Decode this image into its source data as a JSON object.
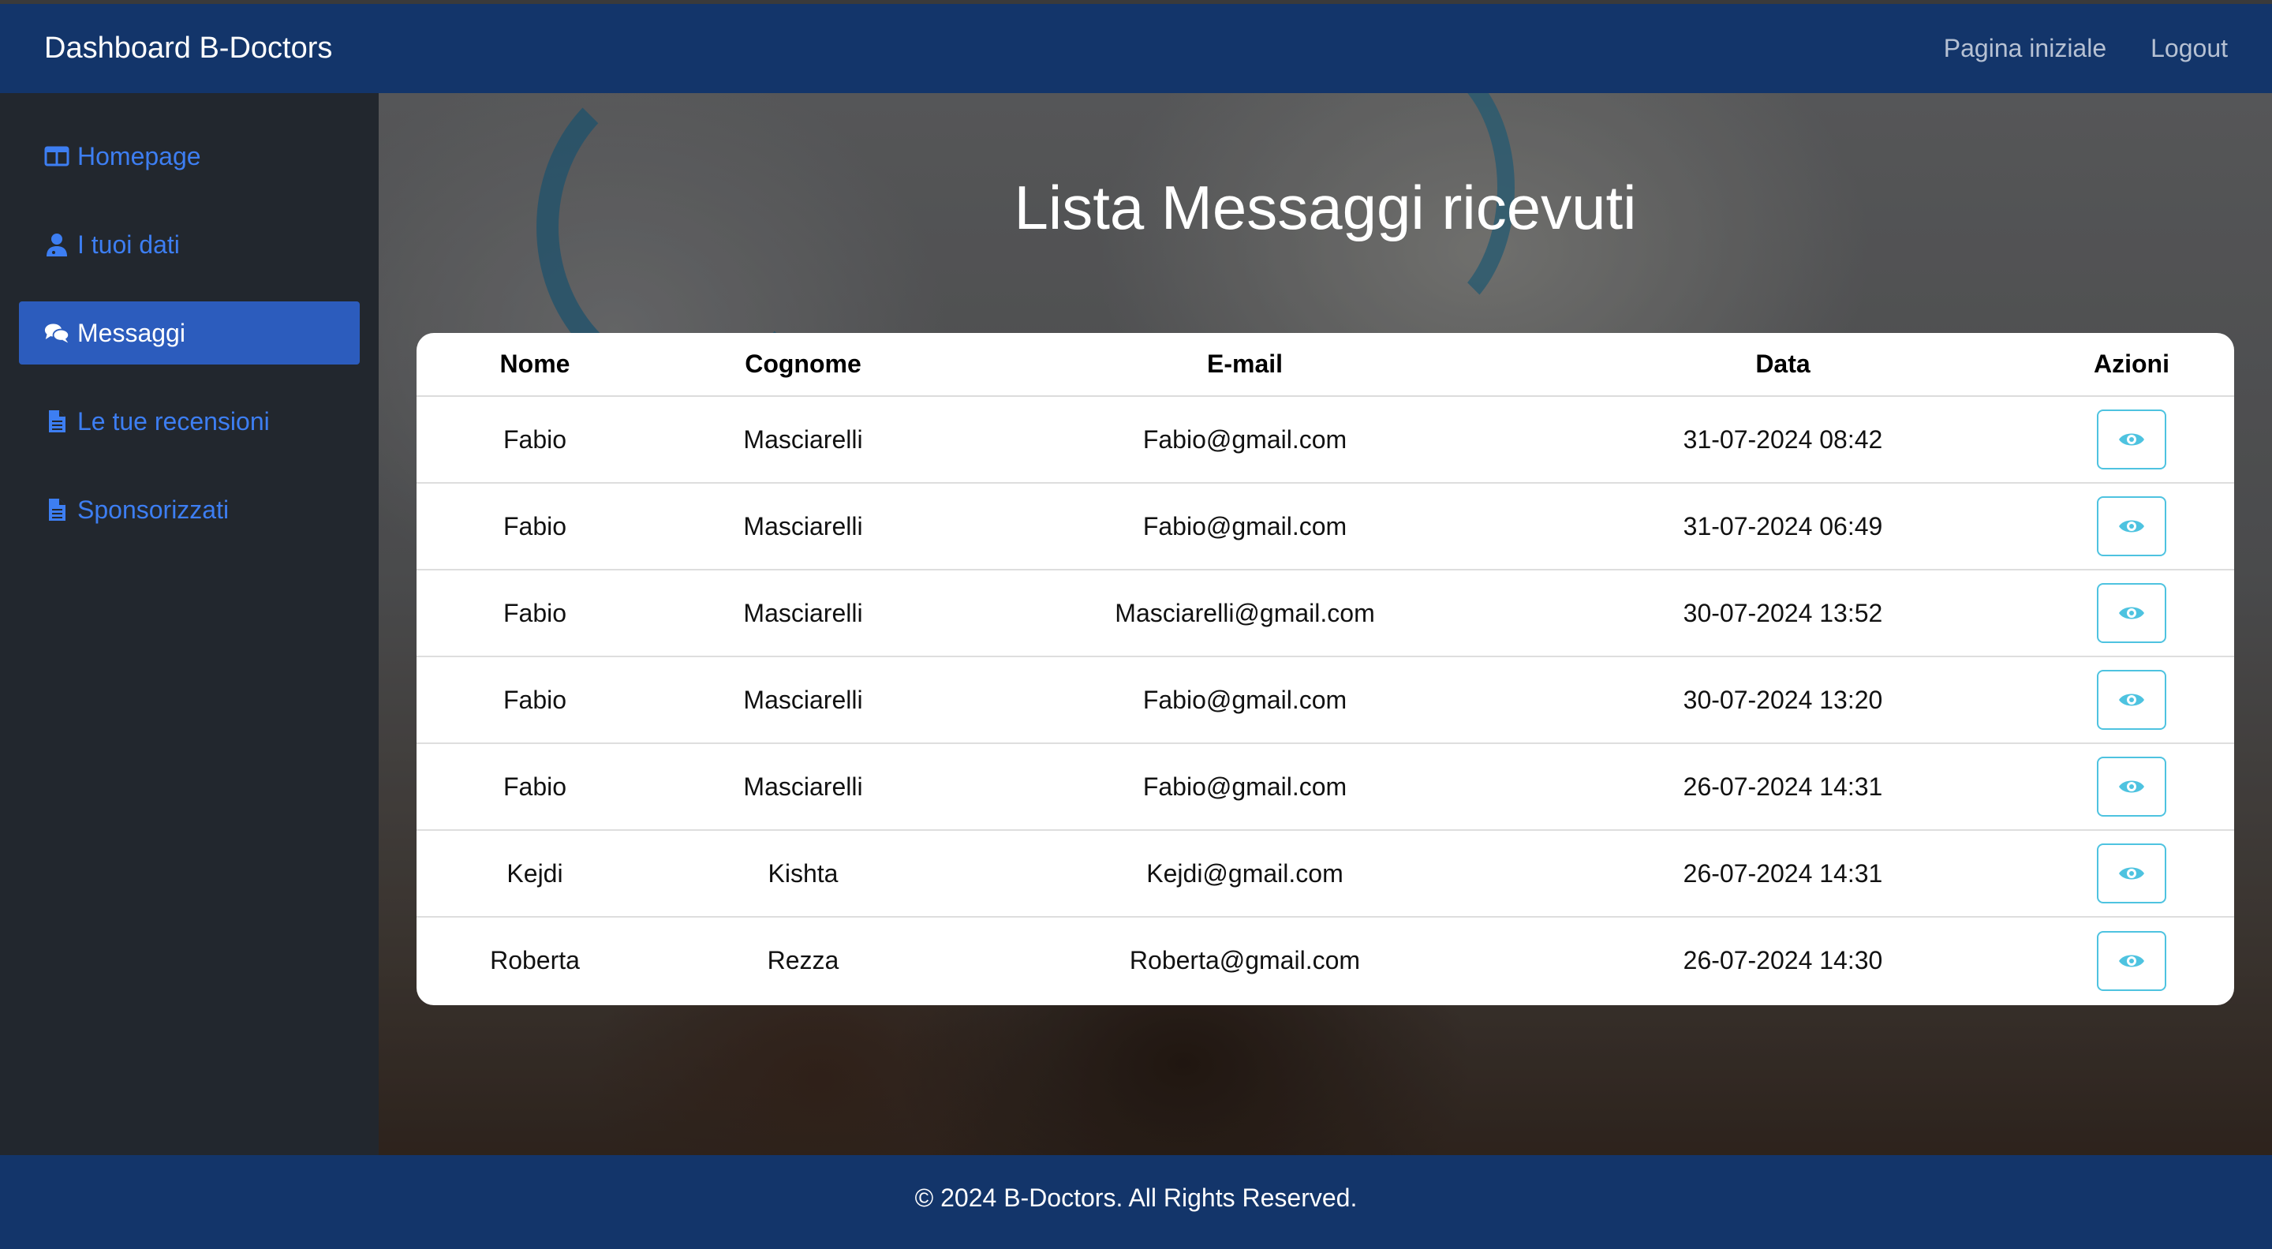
{
  "navbar": {
    "brand": "Dashboard B-Doctors",
    "links": [
      "Pagina iniziale",
      "Logout"
    ]
  },
  "sidebar": {
    "items": [
      {
        "label": "Homepage",
        "icon": "columns-icon"
      },
      {
        "label": "I tuoi dati",
        "icon": "user-doctor-icon"
      },
      {
        "label": "Messaggi",
        "icon": "comments-icon",
        "active": true
      },
      {
        "label": "Le tue recensioni",
        "icon": "file-icon"
      },
      {
        "label": "Sponsorizzati",
        "icon": "file-icon"
      }
    ]
  },
  "main": {
    "title": "Lista Messaggi ricevuti",
    "table": {
      "headers": [
        "Nome",
        "Cognome",
        "E-mail",
        "Data",
        "Azioni"
      ],
      "rows": [
        {
          "nome": "Fabio",
          "cognome": "Masciarelli",
          "email": "Fabio@gmail.com",
          "data": "31-07-2024 08:42"
        },
        {
          "nome": "Fabio",
          "cognome": "Masciarelli",
          "email": "Fabio@gmail.com",
          "data": "31-07-2024 06:49"
        },
        {
          "nome": "Fabio",
          "cognome": "Masciarelli",
          "email": "Masciarelli@gmail.com",
          "data": "30-07-2024 13:52"
        },
        {
          "nome": "Fabio",
          "cognome": "Masciarelli",
          "email": "Fabio@gmail.com",
          "data": "30-07-2024 13:20"
        },
        {
          "nome": "Fabio",
          "cognome": "Masciarelli",
          "email": "Fabio@gmail.com",
          "data": "26-07-2024 14:31"
        },
        {
          "nome": "Kejdi",
          "cognome": "Kishta",
          "email": "Kejdi@gmail.com",
          "data": "26-07-2024 14:31"
        },
        {
          "nome": "Roberta",
          "cognome": "Rezza",
          "email": "Roberta@gmail.com",
          "data": "26-07-2024 14:30"
        }
      ],
      "action_icon": "eye-icon"
    }
  },
  "footer": {
    "text": "© 2024 B-Doctors. All Rights Reserved."
  },
  "colors": {
    "navbar": "#13356a",
    "sidebar": "#22272e",
    "sidebar_active": "#2c5cbd",
    "link": "#3d7ef2",
    "action_outline": "#4ec3e0"
  }
}
